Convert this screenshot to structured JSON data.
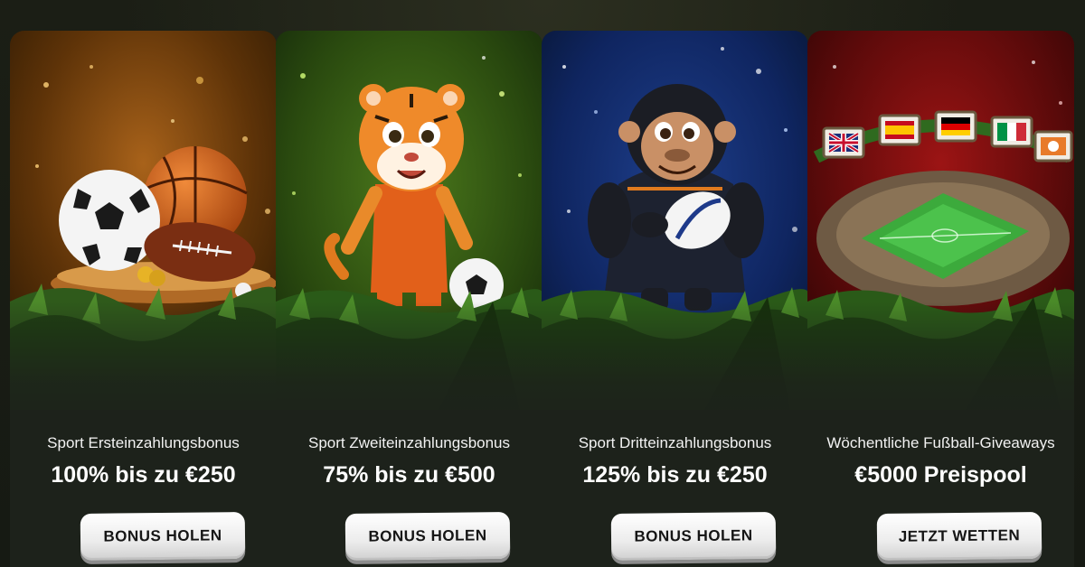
{
  "cards": [
    {
      "title": "Sport Ersteinzahlungsbonus",
      "amount": "100% bis zu €250",
      "button": "BONUS HOLEN",
      "image": "sports-balls-illustration",
      "bg_color": "#6a3a0c"
    },
    {
      "title": "Sport Zweiteinzahlungsbonus",
      "amount": "75% bis zu €500",
      "button": "BONUS HOLEN",
      "image": "tiger-mascot-illustration",
      "bg_color": "#2d4a12"
    },
    {
      "title": "Sport Dritteinzahlungsbonus",
      "amount": "125% bis zu €250",
      "button": "BONUS HOLEN",
      "image": "gorilla-rugby-illustration",
      "bg_color": "#0e2660"
    },
    {
      "title": "Wöchentliche Fußball-Giveaways",
      "amount": "€5000 Preispool",
      "button": "JETZT WETTEN",
      "image": "stadium-flags-illustration",
      "bg_color": "#5e0a0a"
    }
  ]
}
